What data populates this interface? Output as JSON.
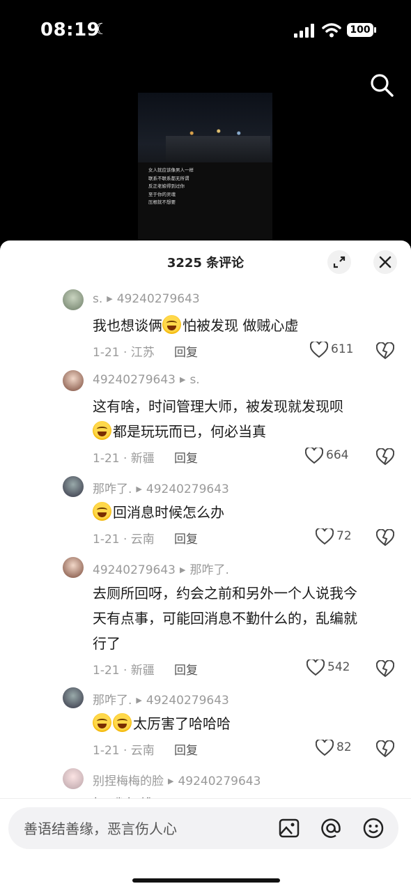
{
  "status": {
    "time": "08:19",
    "battery": "100"
  },
  "video": {
    "caption_lines": [
      "女人就应该像男人一样",
      "联系不联系都无所谓",
      "反正老娘得到过你",
      "至于你的灵魂",
      "压根就不想要"
    ]
  },
  "comments_header": {
    "title": "3225 条评论"
  },
  "comments": [
    {
      "user": "s.",
      "reply_to": "49240279643",
      "text_before": "我也想谈俩",
      "emoji": "rolling-laughing",
      "text_after": "怕被发现 做贼心虚",
      "date_location": "1-21 · 江苏",
      "reply_label": "回复",
      "likes": "611"
    },
    {
      "user": "49240279643",
      "reply_to": "s.",
      "text_line1": "这有啥，时间管理大师，被发现就发现呗",
      "text_line2": "都是玩玩而已，何必当真",
      "emoji": "rolling-laughing",
      "date_location": "1-21 · 新疆",
      "reply_label": "回复",
      "likes": "664"
    },
    {
      "user": "那咋了.",
      "reply_to": "49240279643",
      "text": "回消息时候怎么办",
      "emoji": "crying-laughing",
      "date_location": "1-21 · 云南",
      "reply_label": "回复",
      "likes": "72"
    },
    {
      "user": "49240279643",
      "reply_to": "那咋了.",
      "text_line1": "去厕所回呀，约会之前和另外一个人说我今",
      "text_line2": "天有点事，可能回消息不勤什么的，乱编就",
      "text_line3": "行了",
      "date_location": "1-21 · 新疆",
      "reply_label": "回复",
      "likes": "542"
    },
    {
      "user": "那咋了.",
      "reply_to": "49240279643",
      "text": "太厉害了哈哈哈",
      "emoji": "crying-laughing",
      "date_location": "1-21 · 云南",
      "reply_label": "回复",
      "likes": "82"
    },
    {
      "user": "别捏梅梅的脸",
      "reply_to": "49240279643",
      "text": "好 我师傅"
    }
  ],
  "input": {
    "placeholder": "善语结善缘，恶言伤人心"
  },
  "icons": {
    "search": "search-icon",
    "expand": "expand-icon",
    "close": "close-icon",
    "image": "image-icon",
    "at": "at-icon",
    "emoji": "emoji-icon",
    "like": "heart-icon",
    "dislike": "broken-heart-icon"
  }
}
